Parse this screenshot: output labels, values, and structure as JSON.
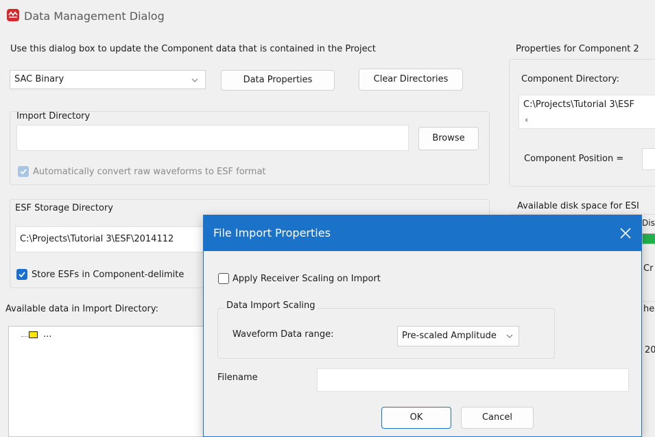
{
  "window": {
    "title": "Data Management Dialog",
    "instructions": "Use this dialog box to update the Component data that is contained in the Project"
  },
  "format_select": {
    "value": "SAC Binary"
  },
  "buttons": {
    "data_properties": "Data Properties",
    "clear_directories": "Clear Directories",
    "browse": "Browse"
  },
  "import_directory": {
    "label": "Import Directory",
    "value": "",
    "auto_convert_label": "Automatically convert raw waveforms to ESF format",
    "auto_convert_checked": true
  },
  "esf_storage": {
    "label": "ESF Storage Directory",
    "value": "C:\\Projects\\Tutorial 3\\ESF\\2014112",
    "store_label": "Store ESFs in Component-delimite",
    "store_checked": true
  },
  "available_data": {
    "label": "Available data in Import Directory:",
    "tree_item": "..."
  },
  "component_properties": {
    "title": "Properties for Component 2",
    "directory_label": "Component Directory:",
    "directory_value": "C:\\Projects\\Tutorial 3\\ESF",
    "position_label": "Component Position ="
  },
  "disk_space": {
    "label": "Available disk space for ESI",
    "sub_label": "Dis",
    "cut1": "Cr",
    "cut2": "he",
    "cut3": "20"
  },
  "file_import_dialog": {
    "title": "File Import Properties",
    "apply_scaling_label": "Apply Receiver Scaling on Import",
    "apply_scaling_checked": false,
    "scaling_group_label": "Data Import Scaling",
    "waveform_range_label": "Waveform Data range:",
    "waveform_range_value": "Pre-scaled Amplitude",
    "filename_label": "Filename",
    "filename_value": "",
    "ok_label": "OK",
    "cancel_label": "Cancel",
    "accent_color": "#1a73c9"
  },
  "colors": {
    "check_blue": "#1a6fcf",
    "dialog_title_bar": "#1a73c9",
    "disk_bar_green": "#22b14c"
  }
}
